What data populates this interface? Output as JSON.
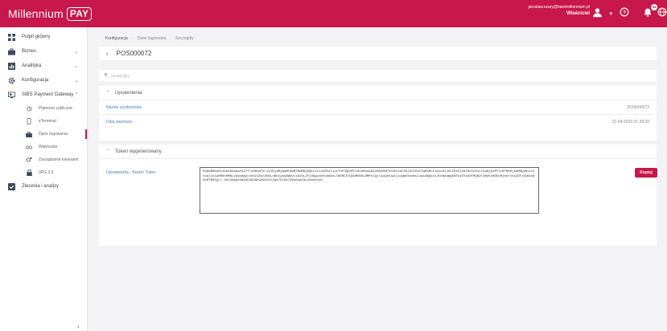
{
  "topbar": {
    "brand": "Millennium",
    "brand_pay": "PAY",
    "user_email": "jaroslaw.szary@bankmillennium.pl",
    "user_role": "Właściciel",
    "notification_count": "41"
  },
  "sidebar": {
    "items": [
      {
        "label": "Pulpit główny",
        "icon": "dashboard-icon"
      },
      {
        "label": "Biznes",
        "icon": "briefcase-icon"
      },
      {
        "label": "Analityka",
        "icon": "chart-icon"
      },
      {
        "label": "Konfiguracja",
        "icon": "gear-icon"
      },
      {
        "label": "SIBS Payment Gateway",
        "icon": "gateway-icon"
      }
    ],
    "subitems": [
      {
        "label": "Platności cykliczne",
        "icon": "cycle-icon"
      },
      {
        "label": "eTerminal",
        "icon": "terminal-icon"
      },
      {
        "label": "Dane logowania",
        "icon": "key-icon"
      },
      {
        "label": "Webhooks",
        "icon": "link-icon"
      },
      {
        "label": "Zarządzanie tokenami",
        "icon": "token-icon"
      },
      {
        "label": "3PG 2.0",
        "icon": "lock-icon"
      }
    ],
    "last_item": {
      "label": "Zlecenia i analizy",
      "icon": "check-icon"
    }
  },
  "breadcrumb": [
    "Konfiguracja",
    "Dane logowania",
    "Szczegóły"
  ],
  "header": {
    "title": "POS000072"
  },
  "filter": {
    "label": "Szukaj filtry"
  },
  "permissions": {
    "title": "Uprawnienia",
    "rows": [
      {
        "label": "Nazwa użytkownika",
        "value": "POS000072"
      },
      {
        "label": "Data ważności",
        "value": "22-09-2033 01:28:20"
      }
    ]
  },
  "token": {
    "title": "Token wygenerowany",
    "label": "Uprawnienia - Bearer Token",
    "value": "0286866d8c46d4bnaaafb27f71069d79.eyJBjaMjAaMTAwMTMwMDQ2NitvIxdv0VzIjoiTUFOQUdFUl8vdRvaZWiZXBvRGF0YS6Isdc3hjXCI6XCIwMzBcIiwicHJjXCI6XCIxNTRcIn0iLCJpbjAiMTYiNTM4MjkwMDQ2NitvIndzIjoiaHR0cHM6Ly9wcmQucz9tZ1Euc3NvLnNhcyAsaWUvLs8i0L2F1dGgvcmVibG9vLTB0RC5TQk9MUNUL8MPUlQxliwidHlwIjoiQmVhcmVyIiwiaWQiOiJtbNeamQ5WTkyOTU2OTMyN2Y1MzEzNDExMjhkYjVjZDFlNjBiNzk5OTM0IQ== 35249a823a9353649b189237c2a9751697d0d82a03c103e5c40",
    "copy_label": "Kopiuj"
  },
  "colors": {
    "brand": "#c8174a",
    "link": "#4a7fb8"
  }
}
